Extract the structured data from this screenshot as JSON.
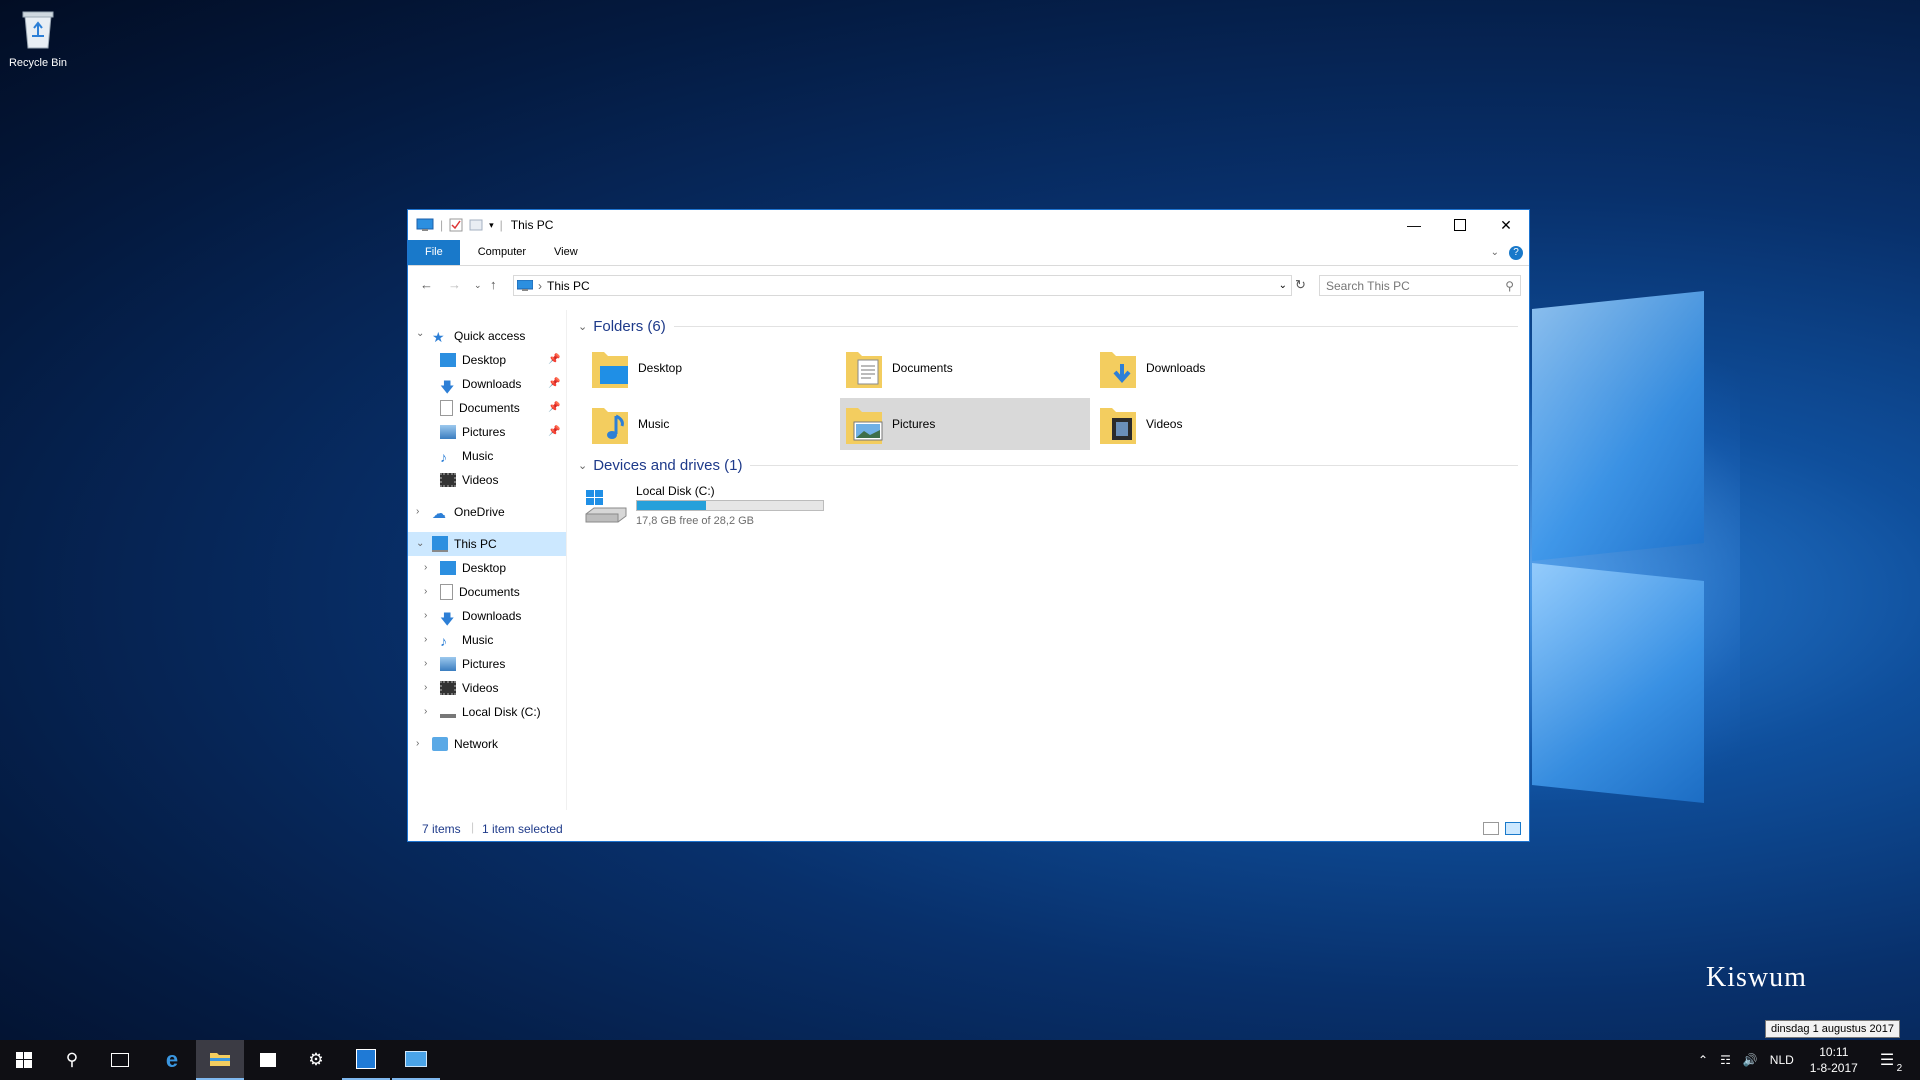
{
  "desktop": {
    "recycle_bin_label": "Recycle Bin",
    "watermark": "Kiswum"
  },
  "window": {
    "title": "This PC",
    "ribbon_tabs": [
      "File",
      "Computer",
      "View"
    ],
    "address_path": "This PC",
    "search_placeholder": "Search This PC",
    "nav": {
      "quick_access": "Quick access",
      "quick_items": [
        "Desktop",
        "Downloads",
        "Documents",
        "Pictures",
        "Music",
        "Videos"
      ],
      "onedrive": "OneDrive",
      "this_pc": "This PC",
      "this_pc_items": [
        "Desktop",
        "Documents",
        "Downloads",
        "Music",
        "Pictures",
        "Videos",
        "Local Disk (C:)"
      ],
      "network": "Network"
    },
    "folders_header": "Folders (6)",
    "folders": [
      "Desktop",
      "Documents",
      "Downloads",
      "Music",
      "Pictures",
      "Videos"
    ],
    "selected_folder": "Pictures",
    "devices_header": "Devices and drives (1)",
    "drive": {
      "name": "Local Disk (C:)",
      "free_text": "17,8 GB free of 28,2 GB",
      "used_fraction": 0.37
    },
    "status_items": "7 items",
    "status_selected": "1 item selected"
  },
  "taskbar": {
    "language": "NLD",
    "time": "10:11",
    "date": "1-8-2017",
    "tooltip": "dinsdag 1 augustus 2017",
    "notification_count": "2"
  },
  "colors": {
    "accent": "#1979ca",
    "folder": "#f3cd5f",
    "selection": "#cce8ff"
  }
}
